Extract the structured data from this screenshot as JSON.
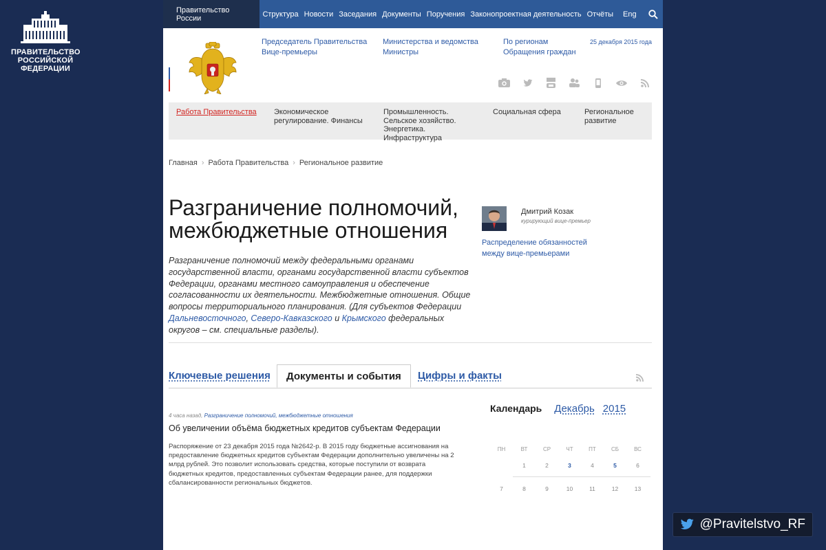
{
  "branding": {
    "gov_name": "ПРАВИТЕЛЬСТВО РОССИЙСКОЙ ФЕДЕРАЦИИ",
    "twitter_handle": "@Pravitelstvo_RF"
  },
  "topnav": {
    "home": "Правительство России",
    "items": [
      "Структура",
      "Новости",
      "Заседания",
      "Документы",
      "Поручения",
      "Законопроектная деятельность",
      "Отчёты"
    ],
    "lang": "Eng"
  },
  "header": {
    "links_col1": [
      "Председатель Правительства",
      "Вице-премьеры"
    ],
    "links_col2": [
      "Министерства и ведомства",
      "Министры"
    ],
    "links_col3": [
      "По регионам",
      "Обращения граждан"
    ],
    "date": "25 декабря 2015 года",
    "social_icons": [
      "camera-icon",
      "twitter-icon",
      "youtube-icon",
      "people-icon",
      "mobile-icon",
      "eye-icon",
      "rss-icon"
    ]
  },
  "categories": [
    "Работа Правительства",
    "Экономическое регулирование. Финансы",
    "Промышленность. Сельское хозяйство. Энергетика. Инфраструктура",
    "Социальная сфера",
    "Региональное развитие"
  ],
  "breadcrumb": [
    "Главная",
    "Работа Правительства",
    "Региональное развитие"
  ],
  "page": {
    "title": "Разграничение полномочий, межбюджетные отношения",
    "intro_part1": "Разграничение полномочий между федеральными органами государственной власти, органами государственной власти субъектов Федерации, органами местного самоуправления и обеспечение согласованности их деятельности. Межбюджетные отношения. Общие вопросы территориального планирования. (Для субъектов Федерации ",
    "intro_link1": "Дальневосточного",
    "intro_sep1": ", ",
    "intro_link2": "Северо-Кавказского",
    "intro_sep2": " и ",
    "intro_link3": "Крымского",
    "intro_part2": " федеральных округов – см. специальные разделы)."
  },
  "curator": {
    "name": "Дмитрий Козак",
    "role": "курирующий вице-премьер",
    "link": "Распределение обязанностей между вице-премьерами"
  },
  "tabs": {
    "key_decisions": "Ключевые решения",
    "documents": "Документы и события",
    "figures": "Цифры и факты"
  },
  "news": {
    "time": "4 часа назад,",
    "topic": "Разграничение полномочий, межбюджетные отношения",
    "title": "Об увеличении объёма бюджетных кредитов субъектам Федерации",
    "body": "Распоряжение от 23 декабря 2015 года №2642-р. В 2015 году бюджетные ассигнования на предоставление бюджетных кредитов субъектам Федерации дополнительно увеличены на 2 млрд рублей. Это позволит использовать средства, которые поступили от возврата бюджетных кредитов, предоставленных субъектам Федерации ранее, для поддержки сбалансированности региональных бюджетов."
  },
  "calendar": {
    "label": "Календарь",
    "month": "Декабрь",
    "year": "2015",
    "weekdays": [
      "ПН",
      "ВТ",
      "СР",
      "ЧТ",
      "ПТ",
      "СБ",
      "ВС"
    ],
    "week1": [
      "",
      "1",
      "2",
      "3",
      "4",
      "5",
      "6"
    ],
    "week2": [
      "7",
      "8",
      "9",
      "10",
      "11",
      "12",
      "13"
    ],
    "event_days": [
      "3",
      "5"
    ]
  },
  "colors": {
    "background": "#1a2c53",
    "topnav": "#2e5a98",
    "link": "#2d5aa6",
    "active_category": "#d2231f"
  }
}
